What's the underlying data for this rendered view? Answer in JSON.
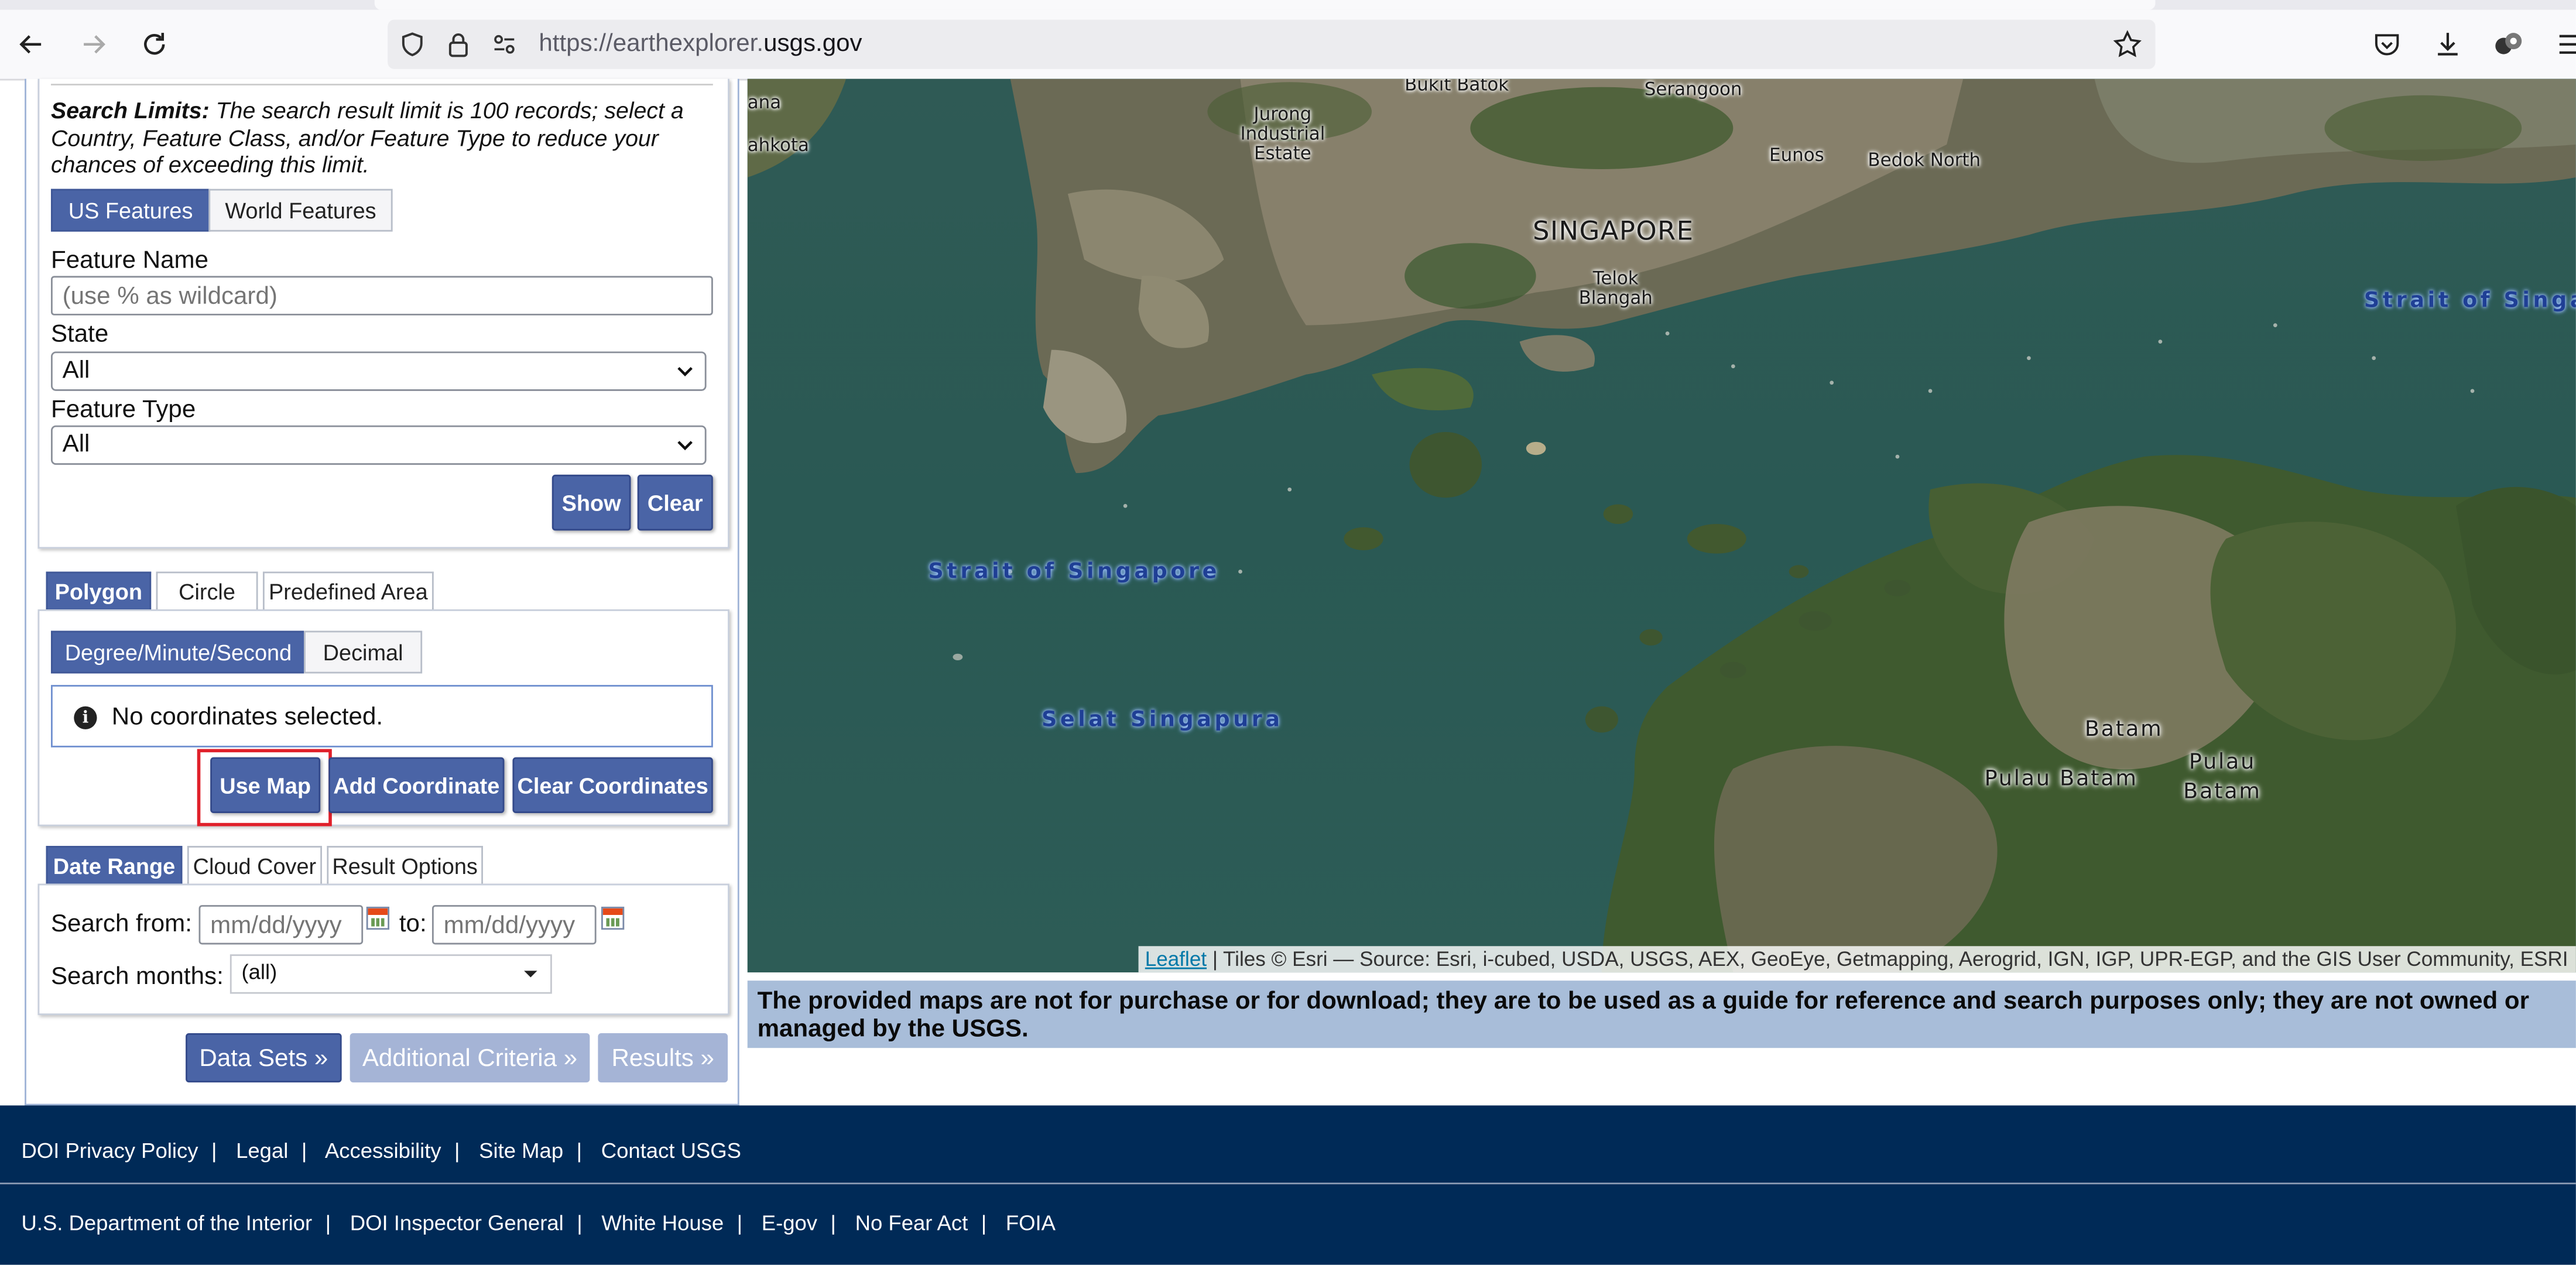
{
  "browser": {
    "url_prefix": "https://earthexplorer.",
    "url_domain": "usgs.gov"
  },
  "search_criteria": {
    "limits_bold": "Search Limits:",
    "limits_text": " The search result limit is 100 records; select a Country, Feature Class, and/or Feature Type to reduce your chances of exceeding this limit.",
    "feature_toggle": [
      "US Features",
      "World Features"
    ],
    "feature_name_label": "Feature Name",
    "feature_name_placeholder": "(use % as wildcard)",
    "state_label": "State",
    "state_value": "All",
    "feature_type_label": "Feature Type",
    "feature_type_value": "All",
    "show_label": "Show",
    "clear_label": "Clear"
  },
  "area_tabs": [
    "Polygon",
    "Circle",
    "Predefined Area"
  ],
  "coord_format": [
    "Degree/Minute/Second",
    "Decimal"
  ],
  "coord_message": "No coordinates selected.",
  "coord_buttons": {
    "use_map": "Use Map",
    "add": "Add Coordinate",
    "clear": "Clear Coordinates"
  },
  "date_tabs": [
    "Date Range",
    "Cloud Cover",
    "Result Options"
  ],
  "date_range": {
    "from_label": "Search from:",
    "from_placeholder": "mm/dd/yyyy",
    "to_label": "to:",
    "to_placeholder": "mm/dd/yyyy",
    "months_label": "Search months:",
    "months_value": "(all)"
  },
  "nav_buttons": {
    "data_sets": "Data Sets »",
    "additional": "Additional Criteria »",
    "results": "Results »"
  },
  "map": {
    "labels": {
      "bukit_batok": "Bukit Batok",
      "serangoon": "Serangoon",
      "jurong": "Jurong\nIndustrial\nEstate",
      "eunos": "Eunos",
      "bedok": "Bedok North",
      "singapore": "SINGAPORE",
      "telok": "Telok\nBlangah",
      "ana": "ana",
      "ahkota": "ahkota",
      "strait_right": "Strait of Singap",
      "strait_left": "Strait of Singapore",
      "selat": "Selat Singapura",
      "batam": "Batam",
      "pulau_batam": "Pulau Batam",
      "pulau_batam2": "Pulau\nBatam"
    },
    "attribution_link": "Leaflet",
    "attribution_text": " | Tiles © Esri — Source: Esri, i-cubed, USDA, USGS, AEX, GeoEye, Getmapping, Aerogrid, IGN, IGP, UPR-EGP, and the GIS User Community, ESRI"
  },
  "disclaimer": "The provided maps are not for purchase or for download; they are to be used as a guide for reference and search purposes only; they are not owned or managed by the USGS.",
  "footer": {
    "row1": [
      "DOI Privacy Policy",
      "Legal",
      "Accessibility",
      "Site Map",
      "Contact USGS"
    ],
    "row2": [
      "U.S. Department of the Interior",
      "DOI Inspector General",
      "White House",
      "E-gov",
      "No Fear Act",
      "FOIA"
    ]
  }
}
